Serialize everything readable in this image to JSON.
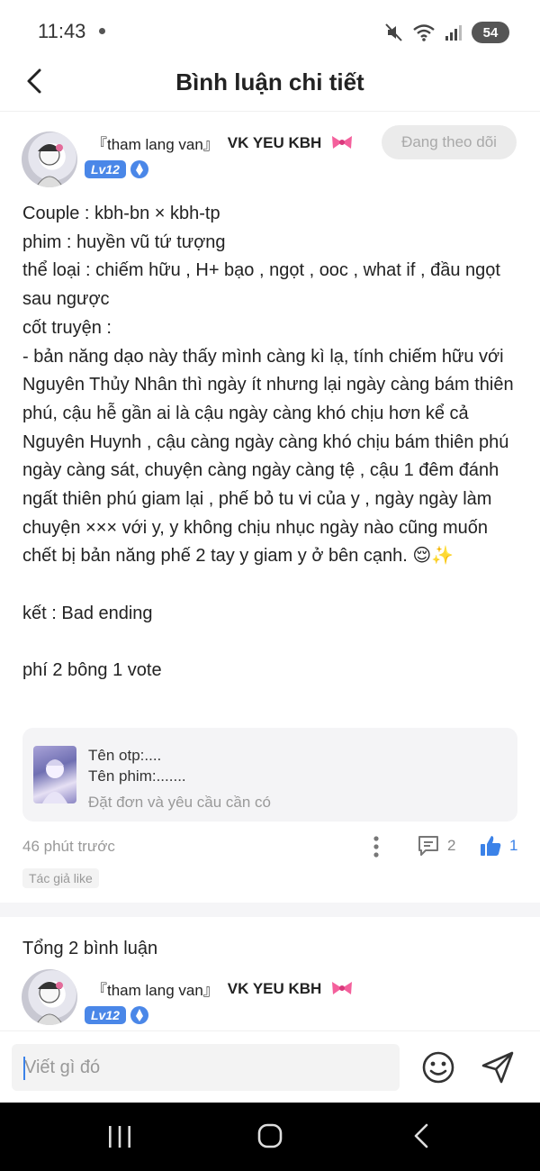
{
  "status_bar": {
    "time": "11:43",
    "battery": "54"
  },
  "header": {
    "title": "Bình luận chi tiết"
  },
  "post": {
    "author": {
      "name": "『tham lang van』",
      "badge_text": "VK YEU KBH",
      "level": "Lv12"
    },
    "follow_label": "Đang theo dõi",
    "body": "Couple : kbh-bn × kbh-tp\nphim : huyền vũ tứ tượng\nthể loại : chiếm hữu , H+ bạo , ngọt , ooc , what if , đầu ngọt sau ngược\ncốt truyện :\n- bản năng dạo này thấy mình càng kì lạ, tính chiếm hữu với Nguyên Thủy Nhân thì ngày ít nhưng lại ngày càng bám thiên phú, cậu hễ gần ai là cậu ngày càng khó chịu hơn kể cả Nguyên Huynh , cậu càng ngày càng khó chịu bám thiên phú ngày càng sát, chuyện càng ngày càng tệ , cậu 1 đêm đánh ngất thiên phú giam lại , phế bỏ tu vi của y , ngày ngày làm chuyện ××× với y, y không chịu nhục ngày nào cũng muốn chết bị bản năng phế 2 tay y giam y ở bên cạnh. 😌✨\n\nkết : Bad ending\n\nphí 2 bông 1 vote",
    "card": {
      "line1": "Tên otp:....",
      "line2": "Tên phim:.......",
      "line3": "Đặt đơn và yêu cầu cần có"
    },
    "time_ago": "46 phút trước",
    "comment_count": "2",
    "like_count": "1",
    "author_liked": "Tác giả like"
  },
  "comments": {
    "total_label": "Tổng 2 bình luận",
    "first": {
      "name": "『tham lang van』",
      "badge_text": "VK YEU KBH",
      "level": "Lv12"
    }
  },
  "compose": {
    "placeholder": "Viết gì đó"
  },
  "colors": {
    "accent": "#3b82e8",
    "level_badge": "#4a87e8",
    "muted_text": "#999999"
  }
}
